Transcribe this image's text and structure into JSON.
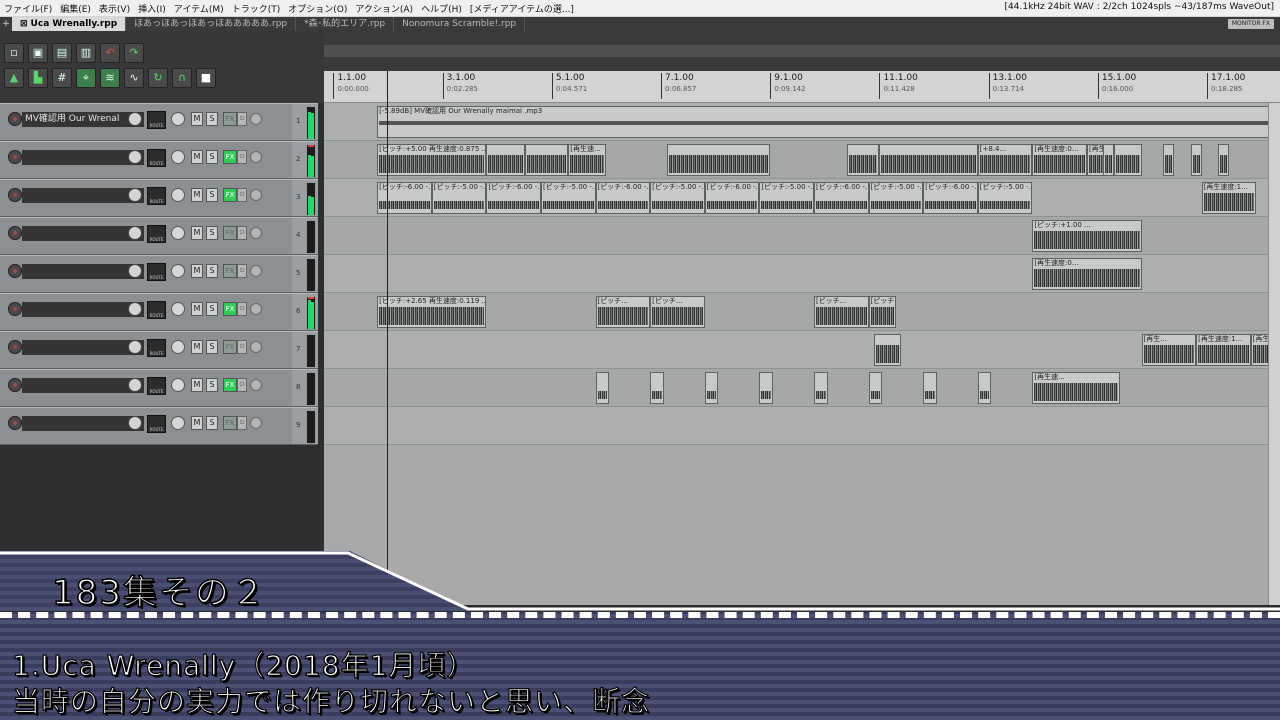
{
  "menubar": {
    "items": [
      "ファイル(F)",
      "編集(E)",
      "表示(V)",
      "挿入(I)",
      "アイテム(M)",
      "トラック(T)",
      "オプション(O)",
      "アクション(A)",
      "ヘルプ(H)",
      "[メディアアイテムの選...]"
    ],
    "status": "[44.1kHz 24bit WAV : 2/2ch 1024spls ~43/187ms WaveOut]"
  },
  "tabs": {
    "close_glyph": "⊠",
    "items": [
      "Uca Wrenally.rpp",
      "ほあっほあっほあっほあああああ.rpp",
      "*森･私的エリア.rpp",
      "Nonomura Scramble!.rpp"
    ],
    "monitor_fx": "MONITOR FX"
  },
  "toolbar": {
    "icons": [
      "new-project-icon",
      "save-icon",
      "open-icon",
      "project-settings-icon",
      "undo-icon",
      "redo-icon",
      "metronome-icon",
      "track-icon",
      "grid-icon",
      "snap-icon",
      "ripple-icon",
      "envelope-icon",
      "loop-icon",
      "magnet-icon",
      "lock-icon"
    ]
  },
  "tracks": [
    {
      "num": "1",
      "name": "MV確認用  Our Wrenal",
      "fx_active": false,
      "meter": 0.85,
      "clip": false
    },
    {
      "num": "2",
      "name": "",
      "fx_active": true,
      "meter": 0.7,
      "clip": true
    },
    {
      "num": "3",
      "name": "",
      "fx_active": true,
      "meter": 0.6,
      "clip": false
    },
    {
      "num": "4",
      "name": "",
      "fx_active": false,
      "meter": 0,
      "clip": false
    },
    {
      "num": "5",
      "name": "",
      "fx_active": false,
      "meter": 0,
      "clip": false
    },
    {
      "num": "6",
      "name": "",
      "fx_active": true,
      "meter": 0.9,
      "clip": true
    },
    {
      "num": "7",
      "name": "",
      "fx_active": false,
      "meter": 0,
      "clip": false
    },
    {
      "num": "8",
      "name": "",
      "fx_active": true,
      "meter": 0,
      "clip": false
    },
    {
      "num": "9",
      "name": "",
      "fx_active": false,
      "meter": 0,
      "clip": false
    }
  ],
  "track_labels": {
    "route": "ROUTE",
    "mute": "M",
    "solo": "S",
    "fx": "FX",
    "power": "⏻"
  },
  "ruler": [
    {
      "bar": "1.1.00",
      "time": "0:00.000"
    },
    {
      "bar": "3.1.00",
      "time": "0:02.285"
    },
    {
      "bar": "5.1.00",
      "time": "0:04.571"
    },
    {
      "bar": "7.1.00",
      "time": "0:06.857"
    },
    {
      "bar": "9.1.00",
      "time": "0:09.142"
    },
    {
      "bar": "11.1.00",
      "time": "0:11.428"
    },
    {
      "bar": "13.1.00",
      "time": "0:13.714"
    },
    {
      "bar": "15.1.00",
      "time": "0:16.000"
    },
    {
      "bar": "17.1.00",
      "time": "0:18.285"
    }
  ],
  "items": [
    {
      "lane": 0,
      "bars": [
        1.9,
        18.4
      ],
      "label": "[-5.89dB] MV確認用  Our Wrenally  maimai .mp3",
      "wave": "thin"
    },
    {
      "lane": 1,
      "bars": [
        1.9,
        3.9
      ],
      "label": "[ピッチ:+5.00 再生速度:0.875 ...",
      "wave": "full"
    },
    {
      "lane": 1,
      "bars": [
        3.9,
        4.6
      ],
      "label": "",
      "wave": "full"
    },
    {
      "lane": 1,
      "bars": [
        4.6,
        5.4
      ],
      "label": "",
      "wave": "full"
    },
    {
      "lane": 1,
      "bars": [
        5.4,
        6.1
      ],
      "label": "[再生速...",
      "wave": "full"
    },
    {
      "lane": 1,
      "bars": [
        7.2,
        9.1
      ],
      "label": "",
      "wave": "full"
    },
    {
      "lane": 1,
      "bars": [
        10.5,
        11.1
      ],
      "label": "",
      "wave": "full"
    },
    {
      "lane": 1,
      "bars": [
        11.1,
        12.9
      ],
      "label": "",
      "wave": "full"
    },
    {
      "lane": 1,
      "bars": [
        12.9,
        13.9
      ],
      "label": "[+8.4...",
      "wave": "full"
    },
    {
      "lane": 1,
      "bars": [
        13.9,
        14.9
      ],
      "label": "[再生速度:0...",
      "wave": "full"
    },
    {
      "lane": 1,
      "bars": [
        14.9,
        15.9
      ],
      "label": "[再生速度...",
      "wave": "full"
    },
    {
      "lane": 1,
      "bars": [
        15.2,
        15.4
      ],
      "label": "",
      "wave": "full"
    },
    {
      "lane": 1,
      "bars": [
        15.4,
        15.9
      ],
      "label": "",
      "wave": "full"
    },
    {
      "lane": 1,
      "bars": [
        16.3,
        16.5
      ],
      "label": "",
      "wave": "full"
    },
    {
      "lane": 1,
      "bars": [
        16.8,
        17.0
      ],
      "label": "",
      "wave": "full"
    },
    {
      "lane": 1,
      "bars": [
        17.3,
        17.5
      ],
      "label": "",
      "wave": "full"
    },
    {
      "lane": 2,
      "bars": [
        1.9,
        2.9
      ],
      "label": "[ピッチ:-6.00 -...",
      "wave": "small"
    },
    {
      "lane": 2,
      "bars": [
        2.9,
        3.9
      ],
      "label": "[ピッチ:-5.00 -...",
      "wave": "small"
    },
    {
      "lane": 2,
      "bars": [
        3.9,
        4.9
      ],
      "label": "[ピッチ:-6.00 -...",
      "wave": "small"
    },
    {
      "lane": 2,
      "bars": [
        4.9,
        5.9
      ],
      "label": "[ピッチ:-5.00 -...",
      "wave": "small"
    },
    {
      "lane": 2,
      "bars": [
        5.9,
        6.9
      ],
      "label": "[ピッチ:-6.00 -...",
      "wave": "small"
    },
    {
      "lane": 2,
      "bars": [
        6.9,
        7.9
      ],
      "label": "[ピッチ:-5.00 -...",
      "wave": "small"
    },
    {
      "lane": 2,
      "bars": [
        7.9,
        8.9
      ],
      "label": "[ピッチ:-6.00 -...",
      "wave": "small"
    },
    {
      "lane": 2,
      "bars": [
        8.9,
        9.9
      ],
      "label": "[ピッチ:-5.00 -...",
      "wave": "small"
    },
    {
      "lane": 2,
      "bars": [
        9.9,
        10.9
      ],
      "label": "[ピッチ:-6.00 -...",
      "wave": "small"
    },
    {
      "lane": 2,
      "bars": [
        10.9,
        11.9
      ],
      "label": "[ピッチ:-5.00 -...",
      "wave": "small"
    },
    {
      "lane": 2,
      "bars": [
        11.9,
        12.9
      ],
      "label": "[ピッチ:-6.00 -...",
      "wave": "small"
    },
    {
      "lane": 2,
      "bars": [
        12.9,
        13.9
      ],
      "label": "[ピッチ:-5.00 -...",
      "wave": "small"
    },
    {
      "lane": 2,
      "bars": [
        17.0,
        18.0
      ],
      "label": "[再生速度:1...",
      "wave": "full"
    },
    {
      "lane": 3,
      "bars": [
        13.9,
        15.9
      ],
      "label": "[ピッチ:+1.00 ...",
      "wave": "full"
    },
    {
      "lane": 4,
      "bars": [
        13.9,
        15.9
      ],
      "label": "[再生速度:0...",
      "wave": "full"
    },
    {
      "lane": 5,
      "bars": [
        1.9,
        3.9
      ],
      "label": "[ピッチ:+2.65 再生速度:0.119 ...",
      "wave": "full"
    },
    {
      "lane": 5,
      "bars": [
        5.9,
        6.9
      ],
      "label": "[ピッチ...",
      "wave": "full"
    },
    {
      "lane": 5,
      "bars": [
        6.9,
        7.9
      ],
      "label": "[ピッチ...",
      "wave": "full"
    },
    {
      "lane": 5,
      "bars": [
        9.9,
        10.9
      ],
      "label": "[ピッチ...",
      "wave": "full"
    },
    {
      "lane": 5,
      "bars": [
        10.9,
        11.4
      ],
      "label": "[ピッチ...",
      "wave": "full"
    },
    {
      "lane": 6,
      "bars": [
        11.0,
        11.5
      ],
      "label": "",
      "wave": "full"
    },
    {
      "lane": 6,
      "bars": [
        15.9,
        16.9
      ],
      "label": "[再生...",
      "wave": "full"
    },
    {
      "lane": 6,
      "bars": [
        16.9,
        17.9
      ],
      "label": "[再生速度:1...",
      "wave": "full"
    },
    {
      "lane": 6,
      "bars": [
        17.9,
        18.4
      ],
      "label": "[再生...",
      "wave": "full"
    },
    {
      "lane": 7,
      "bars": [
        5.9,
        6.15
      ],
      "label": "",
      "wave": "small"
    },
    {
      "lane": 7,
      "bars": [
        6.9,
        7.15
      ],
      "label": "",
      "wave": "small"
    },
    {
      "lane": 7,
      "bars": [
        7.9,
        8.15
      ],
      "label": "",
      "wave": "small"
    },
    {
      "lane": 7,
      "bars": [
        8.9,
        9.15
      ],
      "label": "",
      "wave": "small"
    },
    {
      "lane": 7,
      "bars": [
        9.9,
        10.15
      ],
      "label": "",
      "wave": "small"
    },
    {
      "lane": 7,
      "bars": [
        10.9,
        11.15
      ],
      "label": "",
      "wave": "small"
    },
    {
      "lane": 7,
      "bars": [
        11.9,
        12.15
      ],
      "label": "",
      "wave": "small"
    },
    {
      "lane": 7,
      "bars": [
        12.9,
        13.15
      ],
      "label": "",
      "wave": "small"
    },
    {
      "lane": 7,
      "bars": [
        13.9,
        15.5
      ],
      "label": "[再生速...",
      "wave": "full"
    }
  ],
  "caption": {
    "title": "183集その２",
    "line1": "1.Uca Wrenally（2018年1月頃）",
    "line2": "当時の自分の実力では作り切れないと思い、断念"
  }
}
